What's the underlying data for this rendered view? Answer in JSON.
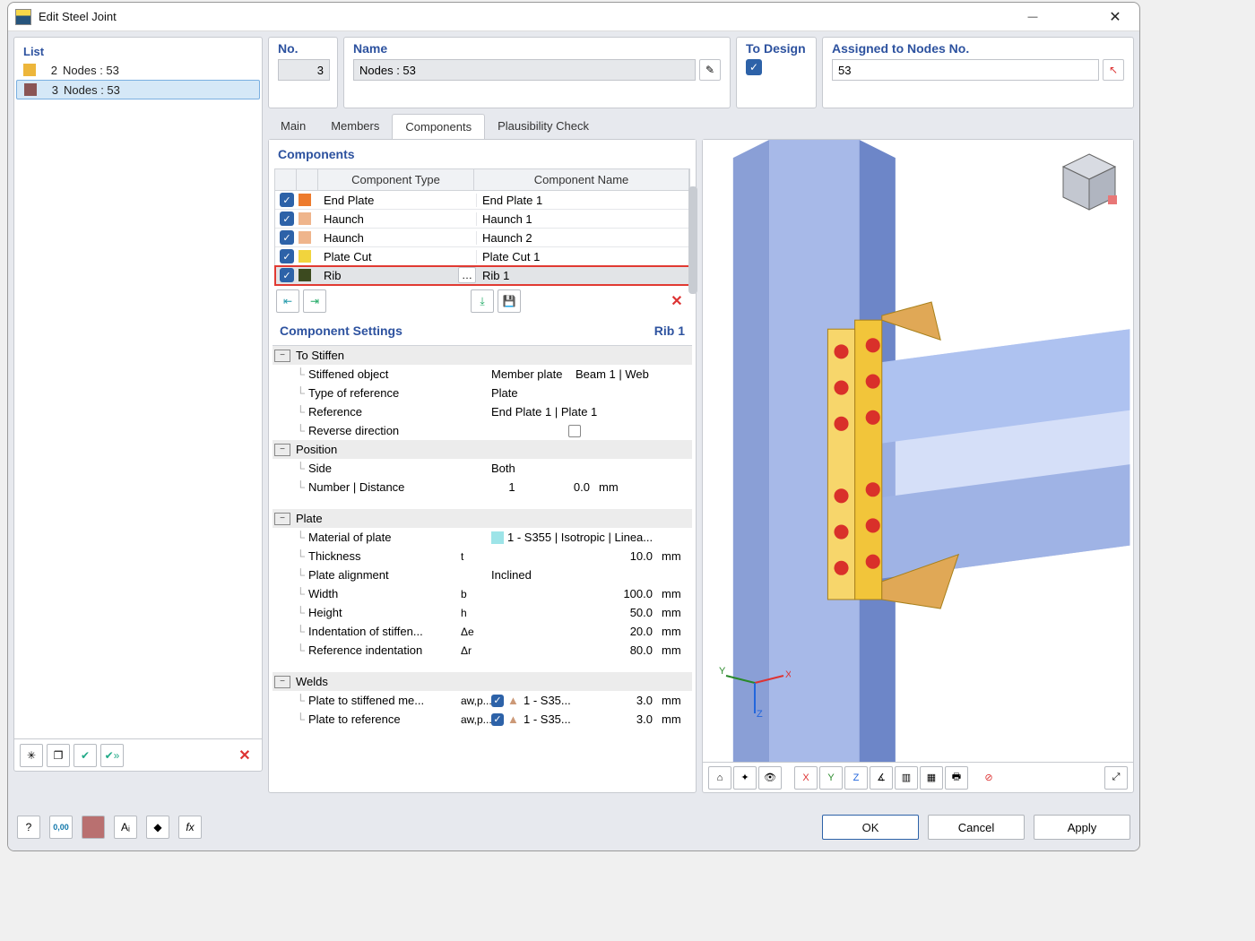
{
  "window": {
    "title": "Edit Steel Joint"
  },
  "list": {
    "title": "List",
    "items": [
      {
        "idx": "2",
        "label": "Nodes : 53",
        "color": "#edb63b",
        "selected": false
      },
      {
        "idx": "3",
        "label": "Nodes : 53",
        "color": "#8a5555",
        "selected": true
      }
    ]
  },
  "fields": {
    "no_label": "No.",
    "no_value": "3",
    "name_label": "Name",
    "name_value": "Nodes : 53",
    "to_design_label": "To Design",
    "assigned_label": "Assigned to Nodes No.",
    "assigned_value": "53"
  },
  "tabs": {
    "main": "Main",
    "members": "Members",
    "components": "Components",
    "plausibility": "Plausibility Check"
  },
  "components": {
    "title": "Components",
    "head_type": "Component Type",
    "head_name": "Component Name",
    "rows": [
      {
        "type": "End Plate",
        "name": "End Plate 1",
        "color": "#ed7b2e",
        "sel": false
      },
      {
        "type": "Haunch",
        "name": "Haunch 1",
        "color": "#efb58c",
        "sel": false
      },
      {
        "type": "Haunch",
        "name": "Haunch 2",
        "color": "#efb58c",
        "sel": false
      },
      {
        "type": "Plate Cut",
        "name": "Plate Cut 1",
        "color": "#f1d43d",
        "sel": false
      },
      {
        "type": "Rib",
        "name": "Rib 1",
        "color": "#3c4a1f",
        "sel": true
      }
    ]
  },
  "settings": {
    "title": "Component Settings",
    "current": "Rib 1",
    "groups": {
      "to_stiffen": "To Stiffen",
      "stiffened_object_l": "Stiffened object",
      "stiffened_object_v": "Member plate",
      "stiffened_object_extra": "Beam 1 | Web",
      "type_ref_l": "Type of reference",
      "type_ref_v": "Plate",
      "reference_l": "Reference",
      "reference_v": "End Plate 1 | Plate 1",
      "reverse_l": "Reverse direction",
      "position": "Position",
      "side_l": "Side",
      "side_v": "Both",
      "numdist_l": "Number | Distance",
      "numdist_n": "1",
      "numdist_d": "0.0",
      "numdist_u": "mm",
      "plate": "Plate",
      "material_l": "Material of plate",
      "material_v": "1 - S355 | Isotropic | Linea...",
      "thickness_l": "Thickness",
      "thickness_s": "t",
      "thickness_v": "10.0",
      "thickness_u": "mm",
      "align_l": "Plate alignment",
      "align_v": "Inclined",
      "width_l": "Width",
      "width_s": "b",
      "width_v": "100.0",
      "width_u": "mm",
      "height_l": "Height",
      "height_s": "h",
      "height_v": "50.0",
      "height_u": "mm",
      "inde_l": "Indentation of stiffen...",
      "inde_s": "Δe",
      "inde_v": "20.0",
      "inde_u": "mm",
      "indr_l": "Reference indentation",
      "indr_s": "Δr",
      "indr_v": "80.0",
      "indr_u": "mm",
      "welds": "Welds",
      "w1_l": "Plate to stiffened me...",
      "w1_s": "aw,p...",
      "w1_m": "1 - S35...",
      "w1_v": "3.0",
      "w1_u": "mm",
      "w2_l": "Plate to reference",
      "w2_s": "aw,p...",
      "w2_m": "1 - S35...",
      "w2_v": "3.0",
      "w2_u": "mm"
    }
  },
  "axis": {
    "x": "X",
    "y": "Y",
    "z": "Z"
  },
  "buttons": {
    "ok": "OK",
    "cancel": "Cancel",
    "apply": "Apply"
  }
}
